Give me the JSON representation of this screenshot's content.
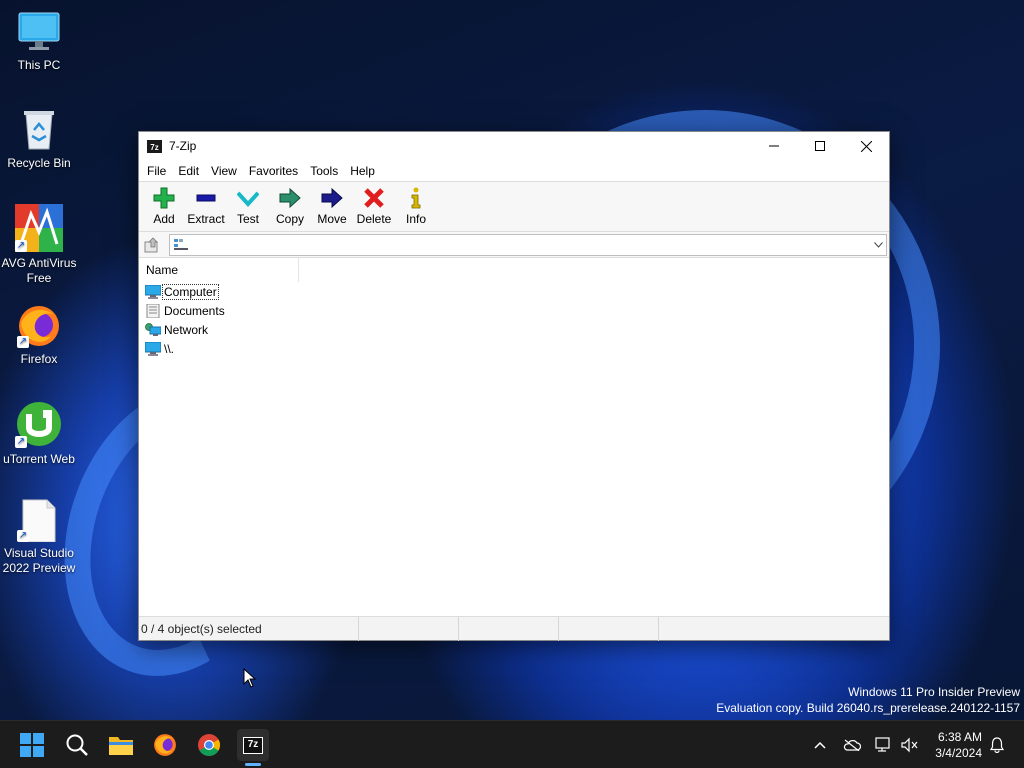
{
  "desktop": {
    "icons": [
      {
        "label": "This PC"
      },
      {
        "label": "Recycle Bin"
      },
      {
        "label": "AVG AntiVirus Free"
      },
      {
        "label": "Firefox"
      },
      {
        "label": "uTorrent Web"
      },
      {
        "label": "Visual Studio 2022 Preview"
      }
    ],
    "watermark": {
      "line1": "Windows 11 Pro Insider Preview",
      "line2": "Evaluation copy. Build 26040.rs_prerelease.240122-1157"
    }
  },
  "window": {
    "title": "7-Zip",
    "app_icon_text": "7z",
    "menu": [
      "File",
      "Edit",
      "View",
      "Favorites",
      "Tools",
      "Help"
    ],
    "toolbar": [
      {
        "label": "Add",
        "icon": "plus-icon"
      },
      {
        "label": "Extract",
        "icon": "minus-icon"
      },
      {
        "label": "Test",
        "icon": "check-icon"
      },
      {
        "label": "Copy",
        "icon": "arrow-right-icon"
      },
      {
        "label": "Move",
        "icon": "arrow-right-icon"
      },
      {
        "label": "Delete",
        "icon": "x-icon"
      },
      {
        "label": "Info",
        "icon": "info-icon"
      }
    ],
    "address": {
      "value": ""
    },
    "list": {
      "column_name": "Name",
      "items": [
        {
          "name": "Computer",
          "icon": "computer-icon",
          "focused": true
        },
        {
          "name": "Documents",
          "icon": "documents-icon",
          "focused": false
        },
        {
          "name": "Network",
          "icon": "network-icon",
          "focused": false
        },
        {
          "name": "\\\\.",
          "icon": "computer-icon",
          "focused": false
        }
      ]
    },
    "status": {
      "selected": "0 / 4 object(s) selected"
    }
  },
  "taskbar": {
    "apps": [
      "start-icon",
      "search-icon",
      "file-explorer-icon",
      "firefox-icon",
      "chrome-icon",
      "7zip-icon"
    ],
    "clock": {
      "time": "6:38 AM",
      "date": "3/4/2024"
    }
  },
  "colors": {
    "add": "#22b14c",
    "extract": "#1a1aa8",
    "test": "#17b8c8",
    "delete": "#e01e1e",
    "info": "#d8b800"
  }
}
